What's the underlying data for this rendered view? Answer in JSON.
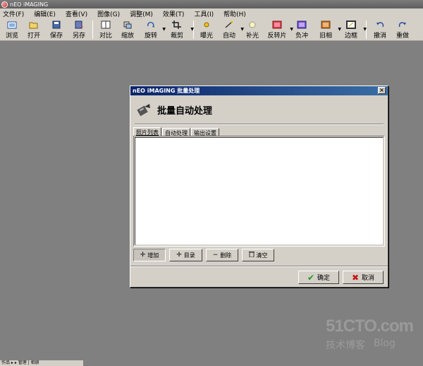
{
  "app": {
    "title": "nEO iMAGING"
  },
  "menu": [
    "文件(F)",
    "编辑(E)",
    "查看(V)",
    "图像(G)",
    "调整(M)",
    "效果(T)",
    "工具(I)",
    "帮助(H)"
  ],
  "toolbar": {
    "items": [
      {
        "label": "浏览",
        "icon": "browse-icon"
      },
      {
        "label": "打开",
        "icon": "folder-open-icon"
      },
      {
        "label": "保存",
        "icon": "save-icon"
      },
      {
        "label": "另存",
        "icon": "save-as-icon"
      },
      {
        "label": "对比",
        "icon": "compare-icon"
      },
      {
        "label": "缩放",
        "icon": "zoom-icon"
      },
      {
        "label": "旋转",
        "icon": "rotate-icon"
      },
      {
        "label": "裁剪",
        "icon": "crop-icon"
      },
      {
        "label": "曝光",
        "icon": "exposure-icon"
      },
      {
        "label": "自动",
        "icon": "auto-icon"
      },
      {
        "label": "补光",
        "icon": "fill-light-icon"
      },
      {
        "label": "反转片",
        "icon": "reversal-film-icon"
      },
      {
        "label": "负冲",
        "icon": "cross-process-icon"
      },
      {
        "label": "旧相",
        "icon": "old-photo-icon"
      },
      {
        "label": "边框",
        "icon": "frame-icon"
      },
      {
        "label": "撤消",
        "icon": "undo-icon"
      },
      {
        "label": "重做",
        "icon": "redo-icon"
      }
    ]
  },
  "dialog": {
    "title": "nEO iMAGING 批量处理",
    "close": "×",
    "heading": "批量自动处理",
    "tabs": [
      "照片列表",
      "自动处理",
      "输出设置"
    ],
    "buttons": {
      "add": "增加",
      "dir": "目录",
      "remove": "删除",
      "clear": "清空",
      "ok": "确定",
      "cancel": "取消"
    }
  },
  "watermark": {
    "site": "51CTO.com",
    "left": "技术博客",
    "right": "Blog"
  },
  "status": "作品 ▸ ▸ 管理 | 相册"
}
